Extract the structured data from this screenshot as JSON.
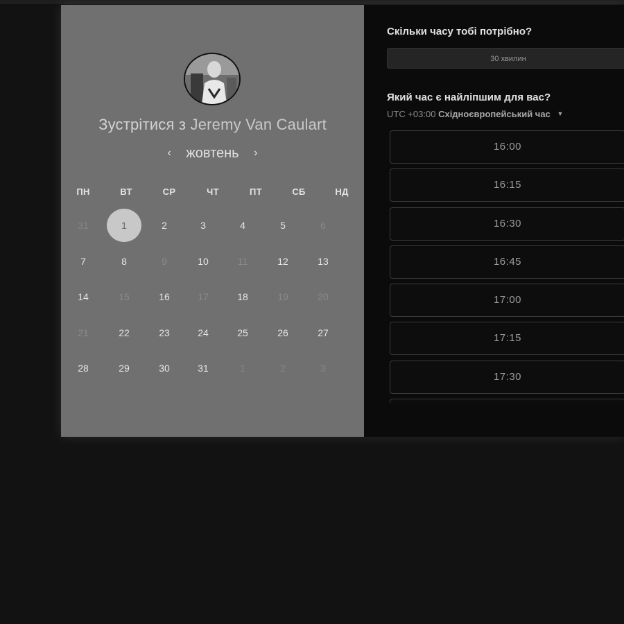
{
  "left_panel": {
    "title_prefix": "Зустрітися з",
    "host_name": "Jeremy Van Caulart",
    "month": "жовтень",
    "prev_arrow": "‹",
    "next_arrow": "›",
    "weekdays": [
      "ПН",
      "ВТ",
      "СР",
      "ЧТ",
      "ПТ",
      "СБ",
      "НД"
    ],
    "weeks": [
      [
        {
          "d": "31",
          "s": "outside"
        },
        {
          "d": "1",
          "s": "selected"
        },
        {
          "d": "2",
          "s": "available"
        },
        {
          "d": "3",
          "s": "available"
        },
        {
          "d": "4",
          "s": "available"
        },
        {
          "d": "5",
          "s": "available"
        },
        {
          "d": "6",
          "s": "unavailable"
        }
      ],
      [
        {
          "d": "7",
          "s": "available"
        },
        {
          "d": "8",
          "s": "available"
        },
        {
          "d": "9",
          "s": "unavailable"
        },
        {
          "d": "10",
          "s": "available"
        },
        {
          "d": "11",
          "s": "unavailable"
        },
        {
          "d": "12",
          "s": "available"
        },
        {
          "d": "13",
          "s": "available"
        }
      ],
      [
        {
          "d": "14",
          "s": "available"
        },
        {
          "d": "15",
          "s": "unavailable"
        },
        {
          "d": "16",
          "s": "available"
        },
        {
          "d": "17",
          "s": "unavailable"
        },
        {
          "d": "18",
          "s": "available"
        },
        {
          "d": "19",
          "s": "unavailable"
        },
        {
          "d": "20",
          "s": "unavailable"
        }
      ],
      [
        {
          "d": "21",
          "s": "unavailable"
        },
        {
          "d": "22",
          "s": "available"
        },
        {
          "d": "23",
          "s": "available"
        },
        {
          "d": "24",
          "s": "available"
        },
        {
          "d": "25",
          "s": "available"
        },
        {
          "d": "26",
          "s": "available"
        },
        {
          "d": "27",
          "s": "available"
        }
      ],
      [
        {
          "d": "28",
          "s": "available"
        },
        {
          "d": "29",
          "s": "available"
        },
        {
          "d": "30",
          "s": "available"
        },
        {
          "d": "31",
          "s": "available"
        },
        {
          "d": "1",
          "s": "outside"
        },
        {
          "d": "2",
          "s": "outside"
        },
        {
          "d": "3",
          "s": "outside"
        }
      ]
    ]
  },
  "right_panel": {
    "duration_question": "Скільки часу тобі потрібно?",
    "duration_value": "30 хвилин",
    "time_question": "Який час є найліпшим для вас?",
    "timezone_offset": "UTC +03:00",
    "timezone_name": "Східноєвропейський час",
    "time_slots": [
      "16:00",
      "16:15",
      "16:30",
      "16:45",
      "17:00",
      "17:15",
      "17:30",
      ""
    ]
  },
  "colors": {
    "left_bg": "#707070",
    "right_bg": "#0b0b0b",
    "page_bg": "#121212",
    "selected_day": "#c8c8c8"
  }
}
